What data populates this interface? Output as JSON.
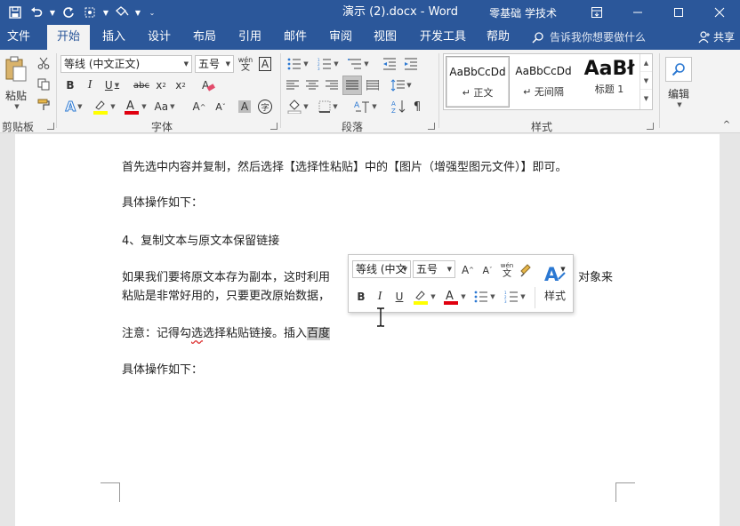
{
  "titlebar": {
    "doc_title": "演示 (2).docx  -  Word",
    "account": "零基础 学技术",
    "bg_color": "#2b579a"
  },
  "tabs": [
    {
      "label": "文件"
    },
    {
      "label": "开始"
    },
    {
      "label": "插入"
    },
    {
      "label": "设计"
    },
    {
      "label": "布局"
    },
    {
      "label": "引用"
    },
    {
      "label": "邮件"
    },
    {
      "label": "审阅"
    },
    {
      "label": "视图"
    },
    {
      "label": "开发工具"
    },
    {
      "label": "帮助"
    }
  ],
  "tell_me": "告诉我你想要做什么",
  "share_label": "共享",
  "ribbon": {
    "clipboard": {
      "paste_label": "粘贴",
      "group_label": "剪贴板"
    },
    "font": {
      "font_name": "等线 (中文正文)",
      "font_size": "五号",
      "group_label": "字体"
    },
    "paragraph": {
      "group_label": "段落"
    },
    "styles": {
      "group_label": "样式",
      "items": [
        {
          "sample": "AaBbCcDd",
          "name": "↵ 正文"
        },
        {
          "sample": "AaBbCcDd",
          "name": "↵ 无间隔"
        },
        {
          "sample": "AaBł",
          "name": "标题 1"
        }
      ]
    },
    "editing": {
      "label": "编辑"
    }
  },
  "document": {
    "lines": [
      "首先选中内容并复制，然后选择【选择性粘贴】中的【图片（增强型图元文件）】即可。",
      "具体操作如下：",
      "4、复制文本与原文本保留链接",
      "如果我们要将原文本存为副本，这时利用",
      "对象来",
      "粘贴是非常好用的，只要更改原始数据，",
      "具体操作如下："
    ],
    "note_prefix": "注意：记得勾",
    "note_squiggle": "选",
    "note_mid": "选择粘贴链接。插入",
    "note_selected": "百度"
  },
  "mini_toolbar": {
    "font_name": "等线 (中文",
    "font_size": "五号",
    "styles_label": "样式"
  },
  "colors": {
    "accent": "#2b579a",
    "highlight": "#ffff00",
    "font_color": "#e0000f"
  }
}
